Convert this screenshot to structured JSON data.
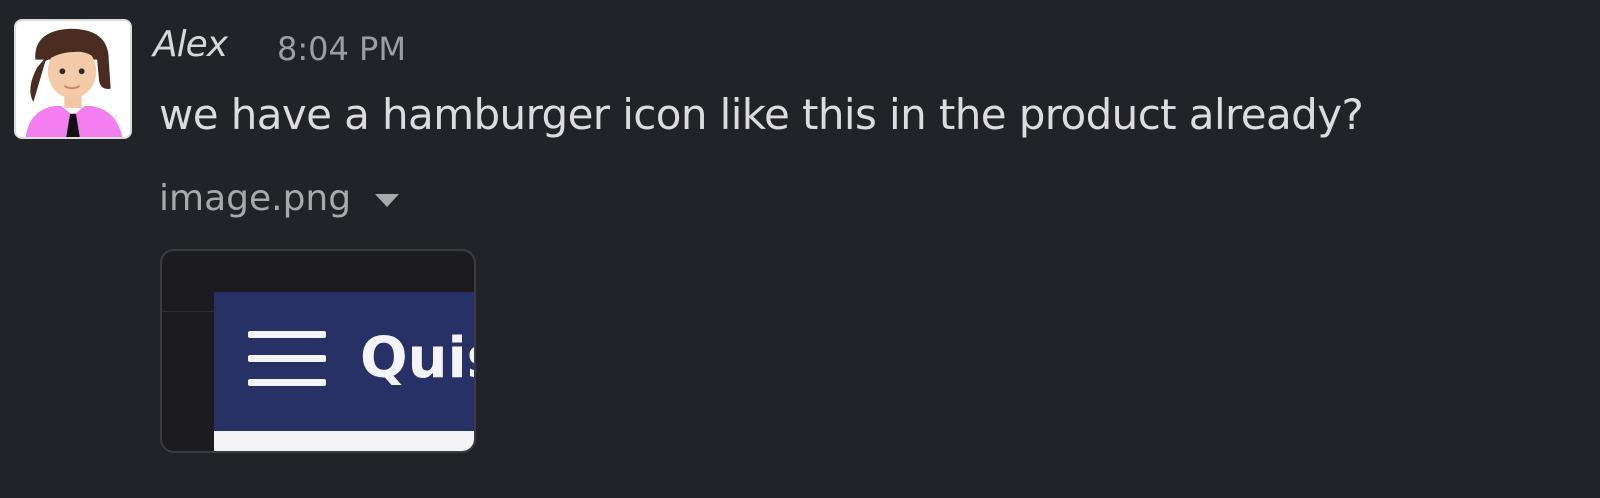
{
  "message": {
    "sender": "Alex",
    "time": "8:04 PM",
    "text": "we have a hamburger icon like this in the product already?"
  },
  "attachment": {
    "file_name": "image.png",
    "preview_title": "Quis"
  },
  "colors": {
    "background": "#222328",
    "appbar": "#283166"
  }
}
